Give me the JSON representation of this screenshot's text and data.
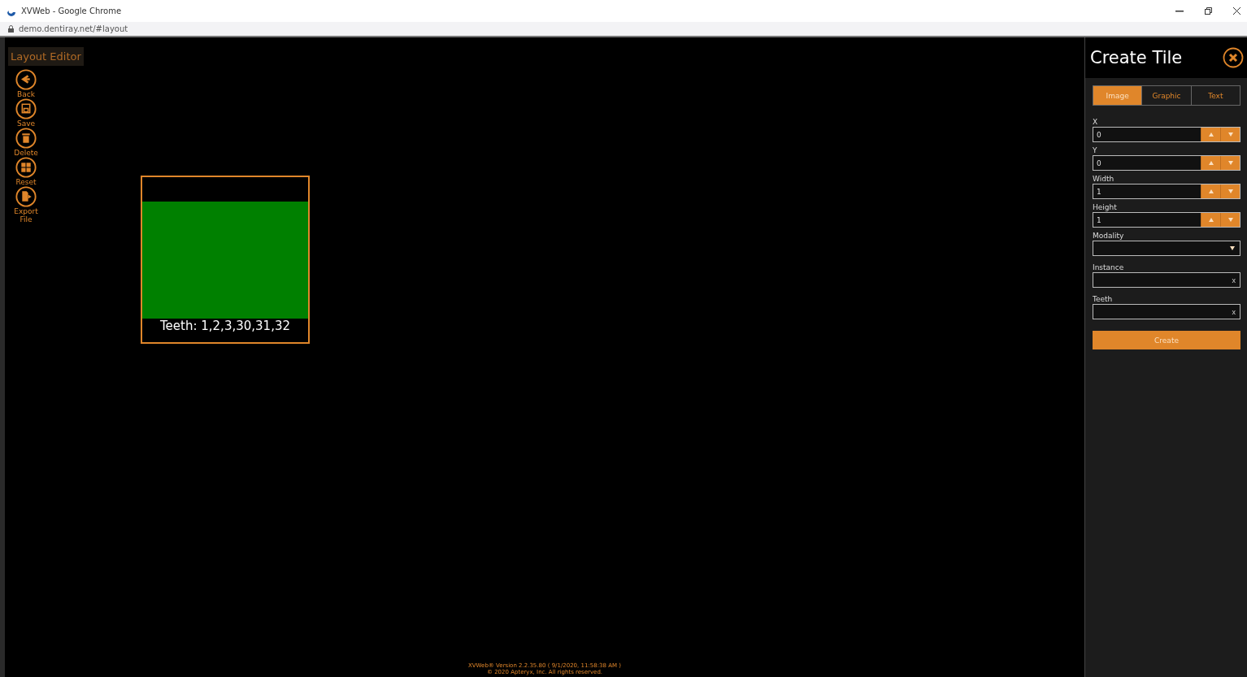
{
  "browser": {
    "title": "XVWeb - Google Chrome",
    "url": "demo.dentiray.net/#layout"
  },
  "header": {
    "title": "Layout Editor"
  },
  "toolbar": [
    {
      "kind": "back",
      "label": "Back"
    },
    {
      "kind": "save",
      "label": "Save"
    },
    {
      "kind": "delete",
      "label": "Delete"
    },
    {
      "kind": "reset",
      "label": "Reset"
    },
    {
      "kind": "export",
      "label": "Export File"
    }
  ],
  "tile": {
    "caption": "Teeth: 1,2,3,30,31,32",
    "color": "#008000"
  },
  "footer": {
    "version": "XVWeb® Version  2.2.35.80 ( 9/1/2020, 11:58:38 AM )",
    "copyright": "© 2020 Apteryx, Inc. All rights reserved."
  },
  "panel": {
    "title": "Create Tile",
    "tabs": [
      {
        "label": "Image",
        "selected": true
      },
      {
        "label": "Graphic",
        "selected": false
      },
      {
        "label": "Text",
        "selected": false
      }
    ],
    "fields": [
      {
        "kind": "spin",
        "label": "X",
        "value": "0"
      },
      {
        "kind": "spin",
        "label": "Y",
        "value": "0"
      },
      {
        "kind": "spin",
        "label": "Width",
        "value": "1"
      },
      {
        "kind": "spin",
        "label": "Height",
        "value": "1"
      },
      {
        "kind": "select",
        "label": "Modality"
      },
      {
        "kind": "clear",
        "label": "Instance",
        "clear": "x"
      },
      {
        "kind": "clear",
        "label": "Teeth",
        "clear": "x"
      }
    ],
    "button": "Create"
  }
}
